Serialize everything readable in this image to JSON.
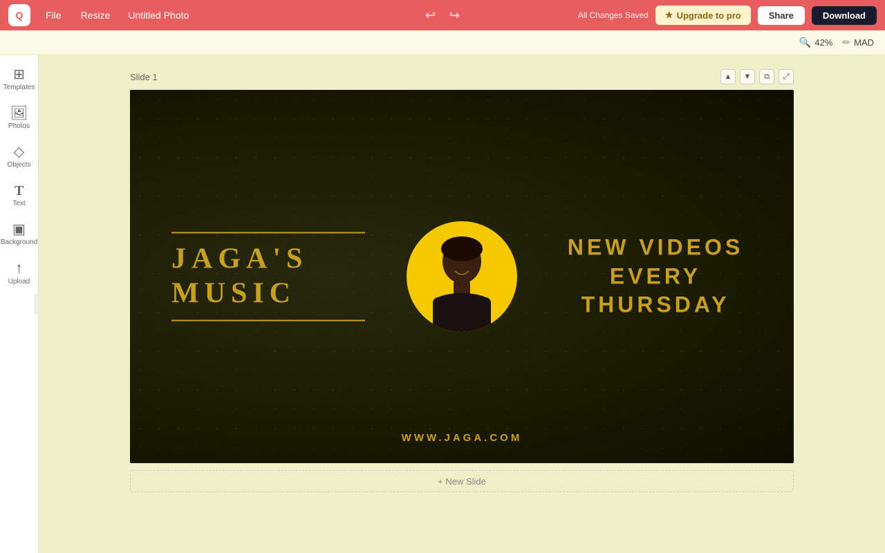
{
  "app": {
    "logo_text": "Q",
    "title": "Untitled Photo",
    "status": "All Changes Saved"
  },
  "topbar": {
    "file_label": "File",
    "resize_label": "Resize",
    "upgrade_label": "Upgrade to pro",
    "share_label": "Share",
    "download_label": "Download",
    "star_icon": "★"
  },
  "zoombar": {
    "zoom_value": "42%",
    "mad_label": "MAD"
  },
  "sidebar": {
    "items": [
      {
        "id": "templates",
        "icon": "⊞",
        "label": "Templates"
      },
      {
        "id": "photos",
        "icon": "🖼",
        "label": "Photos"
      },
      {
        "id": "objects",
        "icon": "◇",
        "label": "Objects"
      },
      {
        "id": "text",
        "icon": "T",
        "label": "Text"
      },
      {
        "id": "background",
        "icon": "▣",
        "label": "Background"
      },
      {
        "id": "upload",
        "icon": "↑",
        "label": "Upload"
      }
    ]
  },
  "slide": {
    "label": "Slide 1",
    "title_line1": "JAGA'S   MUSIC",
    "right_text_line1": "NEW VIDEOS",
    "right_text_line2": "EVERY THURSDAY",
    "url_text": "WWW.JAGA.COM",
    "accent_color": "#c8a020"
  },
  "new_slide_label": "+ New Slide",
  "slide_controls": {
    "up": "▲",
    "down": "▼",
    "copy": "⧉",
    "expand": "⤢"
  }
}
